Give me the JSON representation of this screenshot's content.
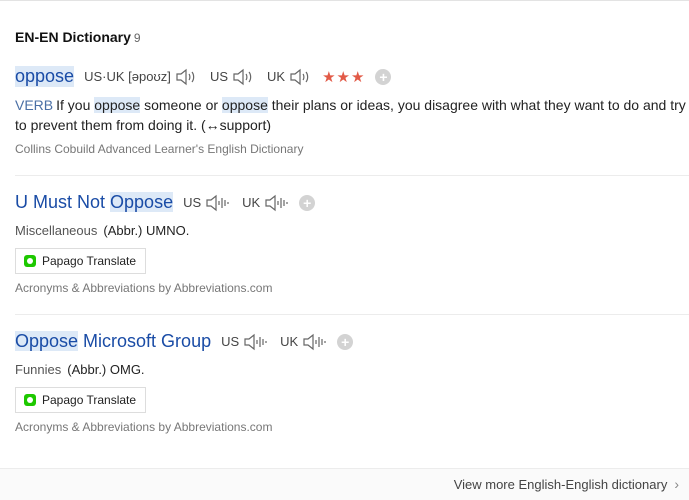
{
  "header": {
    "title": "EN-EN Dictionary",
    "count": "9"
  },
  "entries": [
    {
      "headword": "oppose",
      "pron1_label": "US·UK [əpoʊz]",
      "pron2_label": "US",
      "pron3_label": "UK",
      "stars": "★★★",
      "definition": {
        "pos": "VERB",
        "t1": "If you ",
        "h1": "oppose",
        "t2": " someone or ",
        "h2": "oppose",
        "t3": " their plans or ideas, you disagree with what they want to do and try to prevent them from doing it. (↔support)"
      },
      "source": "Collins Cobuild Advanced Learner's English Dictionary"
    },
    {
      "headword_pre": "U Must Not ",
      "headword_hl": "Oppose",
      "pron1_label": "US",
      "pron2_label": "UK",
      "category": "Miscellaneous",
      "meaning": "(Abbr.) UMNO.",
      "translate_label": "Papago Translate",
      "source": "Acronyms & Abbreviations by Abbreviations.com"
    },
    {
      "headword_hl": "Oppose",
      "headword_post": " Microsoft Group",
      "pron1_label": "US",
      "pron2_label": "UK",
      "category": "Funnies",
      "meaning": "(Abbr.) OMG.",
      "translate_label": "Papago Translate",
      "source": "Acronyms & Abbreviations by Abbreviations.com"
    }
  ],
  "footer": {
    "more_label": "View more English-English dictionary",
    "chevron": "›"
  },
  "icons": {
    "speaker": "speaker-icon",
    "add": "plus-icon",
    "papago": "papago-logo-icon"
  },
  "colors": {
    "link": "#1a4ca6",
    "highlight": "#dde9f7",
    "stars": "#e25a47"
  }
}
